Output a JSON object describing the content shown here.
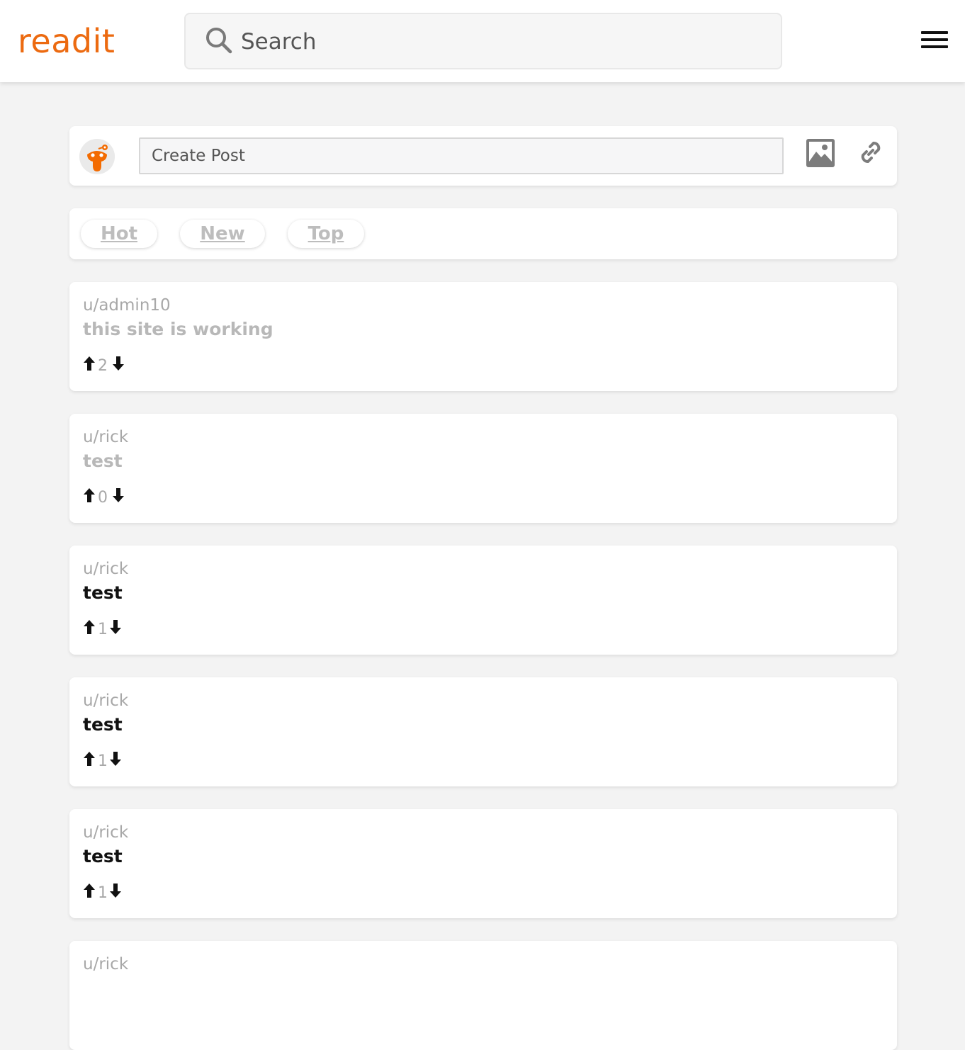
{
  "app": {
    "logo_text": "readit",
    "accent_color": "#ec6a10"
  },
  "header": {
    "search_placeholder": "Search",
    "search_icon": "search-icon",
    "menu_icon": "hamburger-menu-icon"
  },
  "create_post": {
    "avatar_icon": "reddit-alien-avatar-icon",
    "placeholder": "Create Post",
    "image_icon": "image-icon",
    "link_icon": "link-icon"
  },
  "sort": {
    "hot": "Hot",
    "new": "New",
    "top": "Top"
  },
  "posts": [
    {
      "user": "u/admin10",
      "title": "this site is working",
      "score": "2"
    },
    {
      "user": "u/rick",
      "title": "test",
      "score": "0"
    },
    {
      "user": "u/rick",
      "title": "test",
      "score": "1"
    },
    {
      "user": "u/rick",
      "title": "test",
      "score": "1"
    },
    {
      "user": "u/rick",
      "title": "test",
      "score": "1"
    },
    {
      "user": "u/rick",
      "title": "",
      "score": ""
    }
  ]
}
